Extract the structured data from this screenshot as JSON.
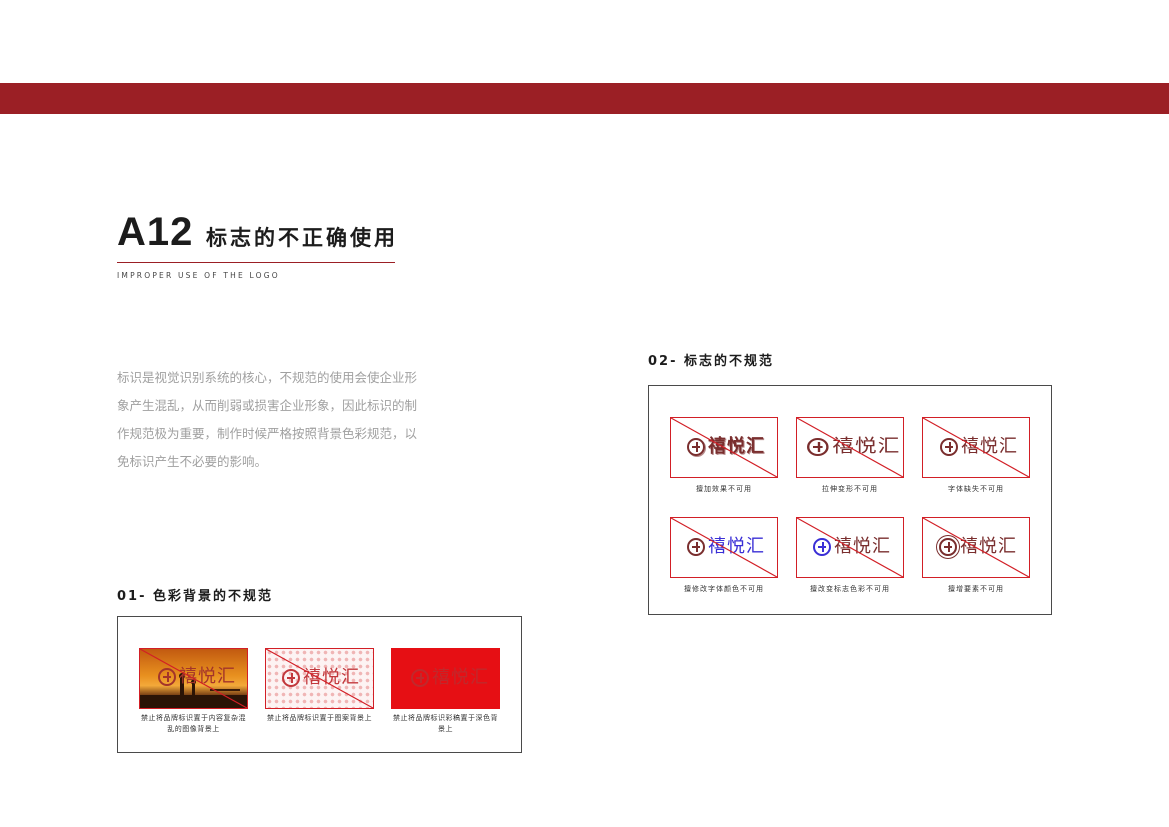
{
  "header": {
    "code": "A12",
    "title": "标志的不正确使用",
    "subtitle": "IMPROPER USE OF THE LOGO"
  },
  "intro": "标识是视觉识别系统的核心，不规范的使用会使企业形象产生混乱，从而削弱或损害企业形象，因此标识的制作规范极为重要，制作时候严格按照背景色彩规范，以免标识产生不必要的影响。",
  "logo_text": "禧悦汇",
  "colors": {
    "brand_dark": "#9b1f25",
    "prohibit_red": "#d21f26",
    "logo_blue": "#3a2fd6",
    "logo_brown": "#7a2e2e"
  },
  "section1": {
    "heading": "01- 色彩背景的不规范",
    "items": [
      {
        "caption": "禁止将品牌标识置于内容复杂混乱的图像背景上"
      },
      {
        "caption": "禁止将品牌标识置于图案背景上"
      },
      {
        "caption": "禁止将品牌标识彩稿置于深色背景上"
      }
    ]
  },
  "section2": {
    "heading": "02- 标志的不规范",
    "items": [
      {
        "caption": "擅加效果不可用"
      },
      {
        "caption": "拉伸变形不可用"
      },
      {
        "caption": "字体缺失不可用"
      },
      {
        "caption": "擅修改字体颜色不可用"
      },
      {
        "caption": "擅改变标志色彩不可用"
      },
      {
        "caption": "擅增要素不可用"
      }
    ]
  }
}
